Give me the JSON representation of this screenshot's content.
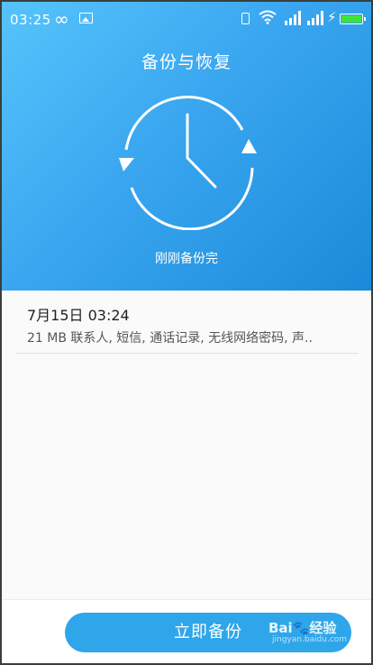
{
  "status_bar": {
    "time": "03:25",
    "infinity_glyph": "∞",
    "icons": [
      "infinity-icon",
      "image-icon",
      "vibrate-icon",
      "wifi-icon",
      "signal-icon",
      "signal-icon",
      "charging-icon",
      "battery-icon"
    ]
  },
  "header": {
    "title": "备份与恢复",
    "status_text": "刚刚备份完"
  },
  "records": [
    {
      "date": "7月15日 03:24",
      "detail": "21 MB   联系人, 短信, 通话记录, 无线网络密码, 声.."
    }
  ],
  "actions": {
    "backup_now": "立即备份"
  },
  "watermark": {
    "brand": "Bai",
    "brand_suffix": "经验",
    "url": "jingyan.baidu.com"
  },
  "colors": {
    "header_gradient_start": "#56c4fb",
    "header_gradient_end": "#1a8ad8",
    "button": "#2fa6ea",
    "battery_fill": "#3ee23e"
  }
}
